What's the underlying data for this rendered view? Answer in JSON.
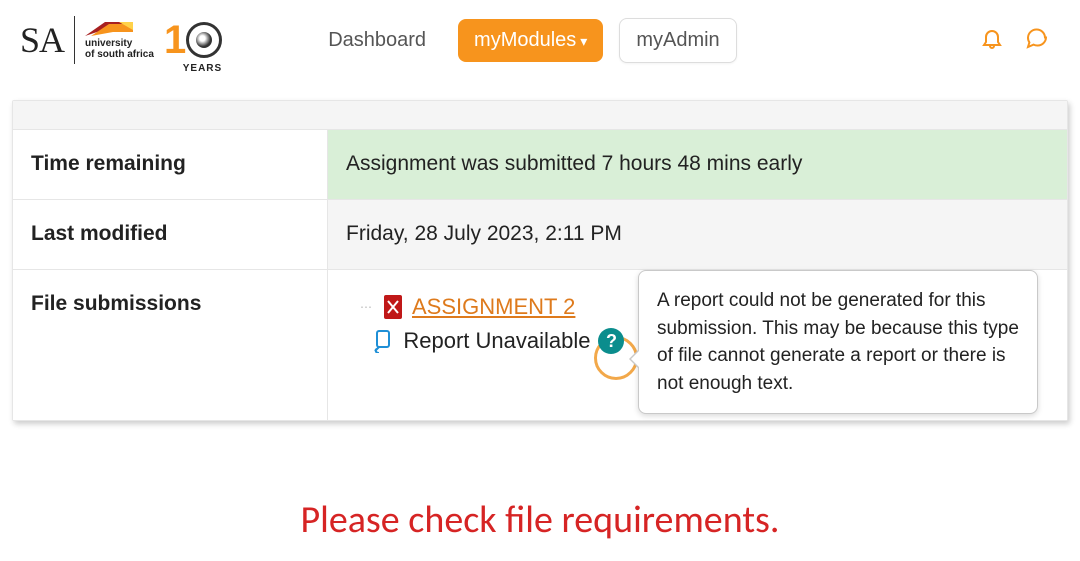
{
  "logo": {
    "sa": "SA",
    "uni_line1": "university",
    "uni_line2": "of south africa",
    "years_digit": "1",
    "years_label": "YEARS"
  },
  "nav": {
    "dashboard": "Dashboard",
    "mymodules": "myModules",
    "myadmin": "myAdmin"
  },
  "rows": {
    "time_remaining_label": "Time remaining",
    "time_remaining_value": "Assignment was submitted 7 hours 48 mins early",
    "last_modified_label": "Last modified",
    "last_modified_value": "Friday, 28 July 2023, 2:11 PM",
    "file_submissions_label": "File submissions"
  },
  "file": {
    "name": "ASSIGNMENT 2",
    "report_status": "Report Unavailable",
    "help_glyph": "?"
  },
  "tooltip": "A report could not be generated for this submission. This may be because this type of file cannot generate a report or there is not enough text.",
  "warning": "Please check file requirements."
}
